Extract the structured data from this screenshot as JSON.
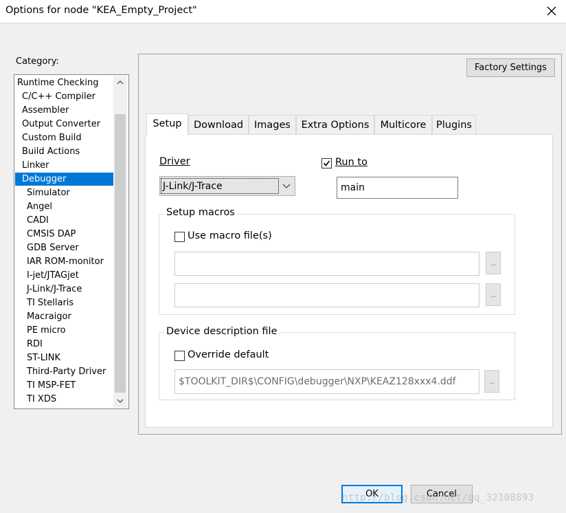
{
  "window": {
    "title": "Options for node \"KEA_Empty_Project\""
  },
  "category": {
    "label": "Category:",
    "items": [
      {
        "label": "Runtime Checking"
      },
      {
        "label": "C/C++ Compiler"
      },
      {
        "label": "Assembler"
      },
      {
        "label": "Output Converter"
      },
      {
        "label": "Custom Build"
      },
      {
        "label": "Build Actions"
      },
      {
        "label": "Linker"
      },
      {
        "label": "Debugger",
        "selected": true
      },
      {
        "label": "Simulator"
      },
      {
        "label": "Angel"
      },
      {
        "label": "CADI"
      },
      {
        "label": "CMSIS DAP"
      },
      {
        "label": "GDB Server"
      },
      {
        "label": "IAR ROM-monitor"
      },
      {
        "label": "I-jet/JTAGjet"
      },
      {
        "label": "J-Link/J-Trace"
      },
      {
        "label": "TI Stellaris"
      },
      {
        "label": "Macraigor"
      },
      {
        "label": "PE micro"
      },
      {
        "label": "RDI"
      },
      {
        "label": "ST-LINK"
      },
      {
        "label": "Third-Party Driver"
      },
      {
        "label": "TI MSP-FET"
      },
      {
        "label": "TI XDS"
      }
    ]
  },
  "factory_settings_label": "Factory Settings",
  "tabs": [
    {
      "label": "Setup",
      "active": true
    },
    {
      "label": "Download"
    },
    {
      "label": "Images"
    },
    {
      "label": "Extra Options"
    },
    {
      "label": "Multicore"
    },
    {
      "label": "Plugins"
    }
  ],
  "setup": {
    "driver_label": "Driver",
    "driver_value": "J-Link/J-Trace",
    "run_to_label": "Run to",
    "run_to_checked": true,
    "run_to_value": "main",
    "macros_group_label": "Setup macros",
    "use_macro_label": "Use macro file(s)",
    "use_macro_checked": false,
    "macro_file_1": "",
    "macro_file_2": "",
    "device_group_label": "Device description file",
    "override_label": "Override default",
    "override_checked": false,
    "device_file_value": "$TOOLKIT_DIR$\\CONFIG\\debugger\\NXP\\KEAZ128xxx4.ddf",
    "browse_label": "..."
  },
  "footer": {
    "ok_label": "OK",
    "cancel_label": "Cancel",
    "watermark": "http://blog.csdn.net/qq_32108893"
  },
  "colors": {
    "selection": "#0078d7",
    "window_bg": "#f0f0f0"
  }
}
